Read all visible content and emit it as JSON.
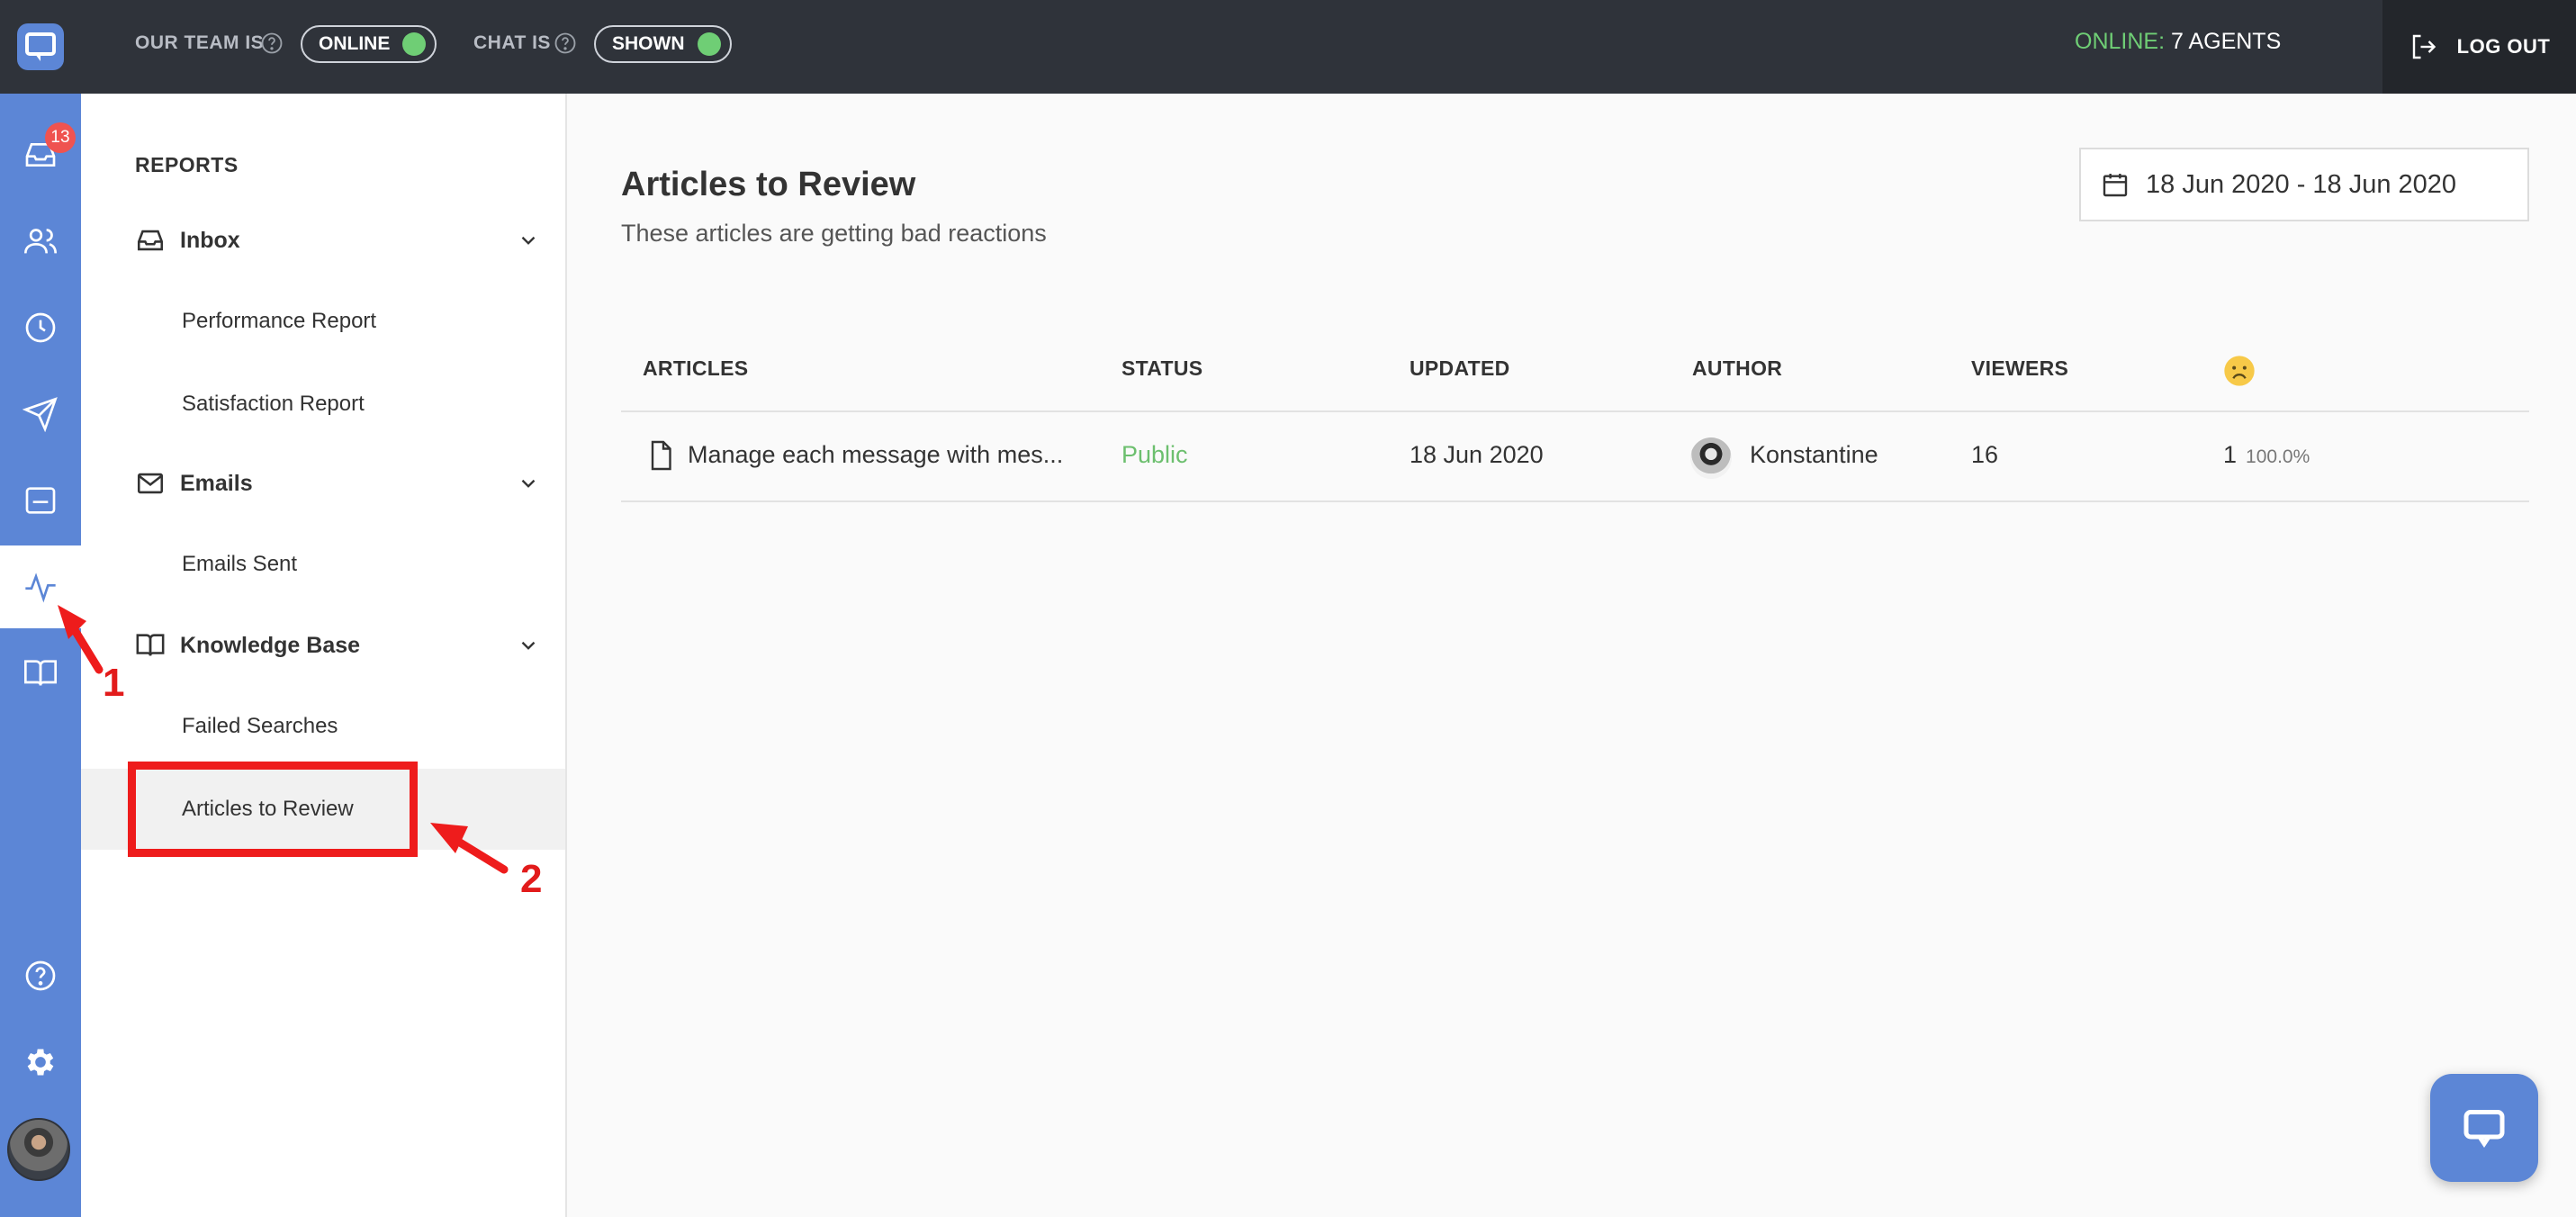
{
  "topbar": {
    "team_label": "OUR TEAM IS",
    "team_toggle": "ONLINE",
    "chat_label": "CHAT IS",
    "chat_toggle": "SHOWN",
    "online_label": "ONLINE:",
    "online_value": "7 AGENTS",
    "logout_label": "LOG OUT"
  },
  "rail": {
    "inbox_badge": "13",
    "icons": [
      "inbox-icon",
      "people-icon",
      "clock-icon",
      "send-icon",
      "card-icon",
      "reports-icon",
      "book-icon",
      "help-icon",
      "gear-icon"
    ],
    "active": "reports-icon"
  },
  "sidebar": {
    "heading": "REPORTS",
    "groups": [
      {
        "label": "Inbox",
        "items": [
          "Performance Report",
          "Satisfaction Report"
        ]
      },
      {
        "label": "Emails",
        "items": [
          "Emails Sent"
        ]
      },
      {
        "label": "Knowledge Base",
        "items": [
          "Failed Searches",
          "Articles to Review"
        ]
      }
    ],
    "active_item": "Articles to Review"
  },
  "main": {
    "title": "Articles to Review",
    "subtitle": "These articles are getting bad reactions",
    "date_range": "18 Jun 2020 - 18 Jun 2020",
    "columns": [
      "ARTICLES",
      "STATUS",
      "UPDATED",
      "AUTHOR",
      "VIEWERS"
    ],
    "rows": [
      {
        "article": "Manage each message with mes...",
        "status": "Public",
        "updated": "18 Jun 2020",
        "author": "Konstantine",
        "viewers": "16",
        "sad_count": "1",
        "sad_pct": "100.0%"
      }
    ]
  },
  "annotations": {
    "step1": "1",
    "step2": "2"
  },
  "colors": {
    "rail": "#5c86d6",
    "topbar": "#2f333a",
    "online_green": "#6fce75",
    "status_green": "#6cbf6e",
    "annotation_red": "#ee1c1c"
  }
}
